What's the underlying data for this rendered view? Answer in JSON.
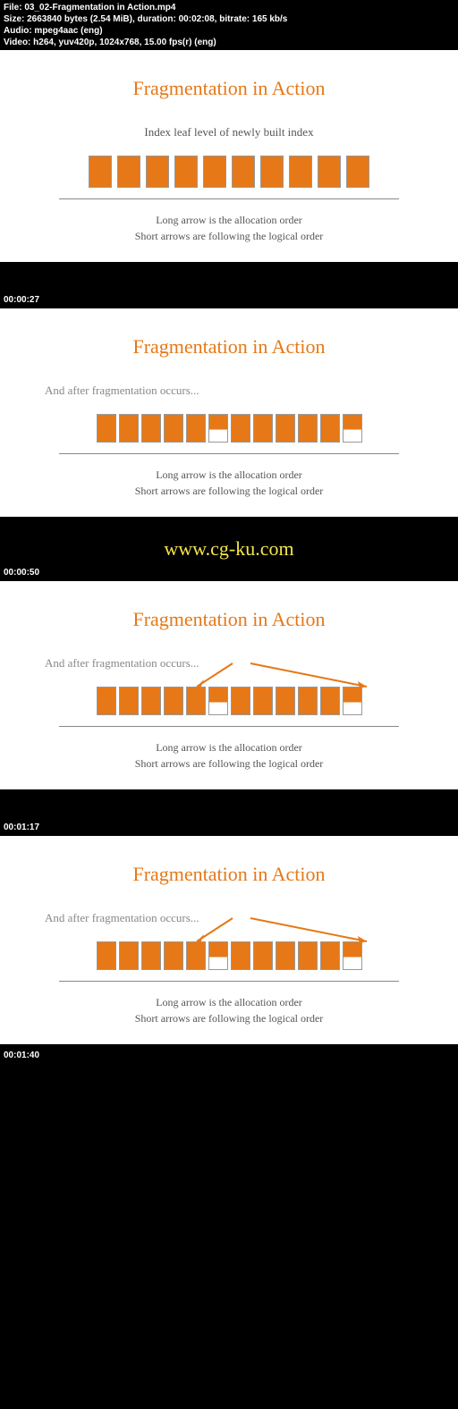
{
  "file_info": {
    "line1": "File: 03_02-Fragmentation in Action.mp4",
    "line2": "Size: 2663840 bytes (2.54 MiB), duration: 00:02:08, bitrate: 165 kb/s",
    "line3": "Audio: mpeg4aac (eng)",
    "line4": "Video: h264, yuv420p, 1024x768, 15.00 fps(r) (eng)"
  },
  "slides": {
    "title": "Fragmentation in Action",
    "s1_subtitle": "Index leaf level of newly built index",
    "s2_subtitle": "And after fragmentation occurs...",
    "caption_line1": "Long arrow is the allocation order",
    "caption_line2": "Short arrows are following the logical order"
  },
  "timestamps": {
    "t1": "00:00:27",
    "t2": "00:00:50",
    "t3": "00:01:17",
    "t4": "00:01:40"
  },
  "watermark": "www.cg-ku.com"
}
